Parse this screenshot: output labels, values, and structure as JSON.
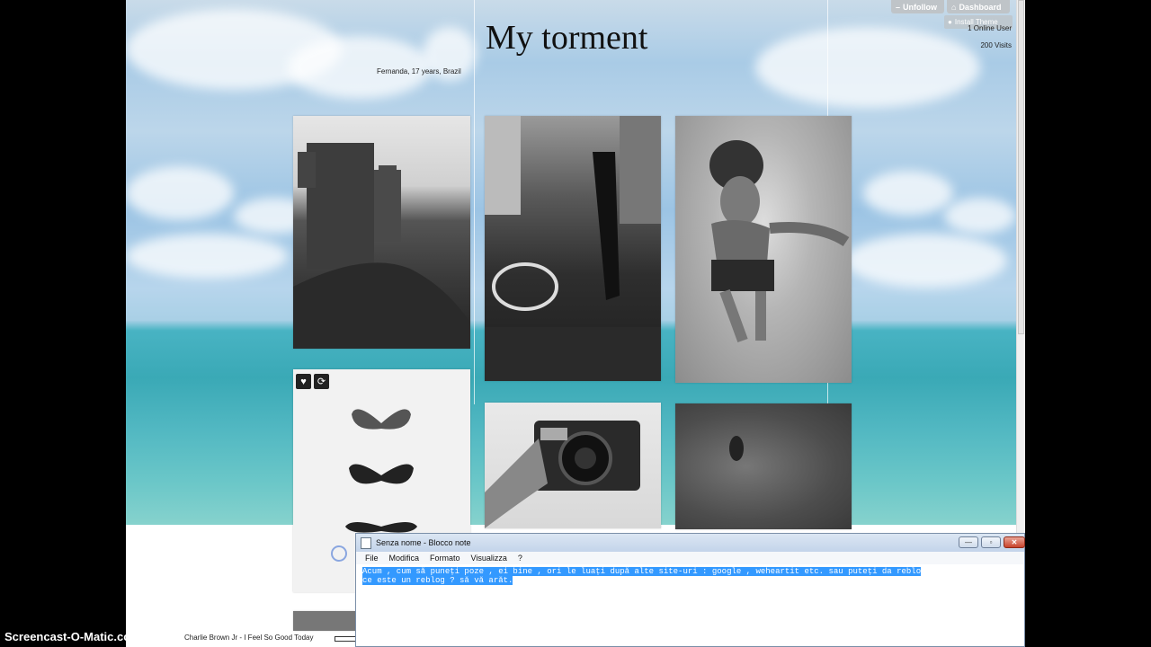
{
  "blog": {
    "title": "My torment",
    "subtitle": "Fernanda, 17 years, Brazil",
    "online_users": "1 Online User",
    "visits": "200 Visits"
  },
  "tumblr_controls": {
    "unfollow": "Unfollow",
    "dashboard": "Dashboard",
    "install_theme": "Install Theme"
  },
  "posts": [
    {
      "subject": "castle",
      "icon": "castle-photo"
    },
    {
      "subject": "car with legs",
      "icon": "car-photo"
    },
    {
      "subject": "underwater swimmer",
      "icon": "swimmer-photo"
    },
    {
      "subject": "butterflies",
      "icon": "butterflies-photo"
    },
    {
      "subject": "camera",
      "icon": "camera-photo"
    },
    {
      "subject": "water",
      "icon": "water-photo"
    }
  ],
  "post_actions": {
    "like": "♥",
    "reblog": "⟳"
  },
  "music_player": {
    "track": "Charlie Brown Jr - I Feel So Good Today"
  },
  "notepad": {
    "window_title": "Senza nome - Blocco note",
    "menu": [
      "File",
      "Modifica",
      "Formato",
      "Visualizza",
      "?"
    ],
    "line1": "Acum , cum să puneți poze , ei bine , ori le luați după alte site-uri : google , weheartit etc. sau puteți da reblo",
    "line2": "ce este un reblog ?  să vă arăt."
  },
  "watermark": "Screencast-O-Matic.com"
}
